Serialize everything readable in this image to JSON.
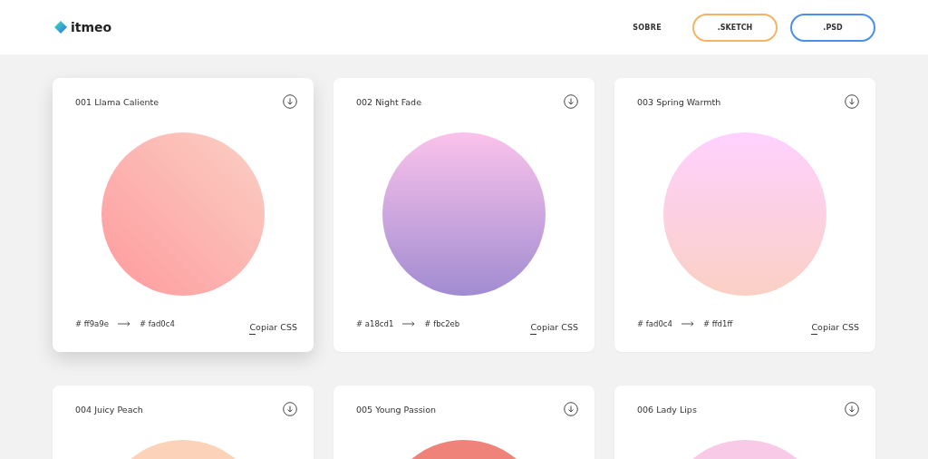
{
  "header": {
    "logo": "itmeo",
    "nav_link": "SOBRE",
    "buttons": [
      {
        "label": ".SKETCH",
        "color": "#f5b463"
      },
      {
        "label": ".PSD",
        "color": "#4a8ef0"
      }
    ]
  },
  "cards": [
    {
      "title": "001 Llama Caliente",
      "stops": [
        {
          "color": "#ff9a9e"
        },
        {
          "color": "#fad0c4"
        }
      ],
      "from": "# ff9a9e",
      "to": "# fad0c4",
      "copy": "Copiar CSS",
      "raised": true
    },
    {
      "title": "002 Night Fade",
      "stops": [
        {
          "color": "#a18cd1"
        },
        {
          "color": "#fbc2eb"
        }
      ],
      "from": "# a18cd1",
      "to": "# fbc2eb",
      "copy": "Copiar CSS",
      "raised": false
    },
    {
      "title": "003 Spring Warmth",
      "stops": [
        {
          "color": "#fad0c4"
        },
        {
          "color": "#ffd1ff"
        }
      ],
      "from": "# fad0c4",
      "to": "# ffd1ff",
      "copy": "Copiar CSS",
      "raised": false
    },
    {
      "title": "004 Juicy Peach",
      "stops": [
        {
          "color": "#fcd3b8"
        }
      ],
      "raised": false
    },
    {
      "title": "005 Young Passion",
      "stops": [
        {
          "color": "#ef8379"
        }
      ],
      "raised": false
    },
    {
      "title": "006 Lady Lips",
      "stops": [
        {
          "color": "#f9c9e8"
        }
      ],
      "raised": false
    }
  ]
}
